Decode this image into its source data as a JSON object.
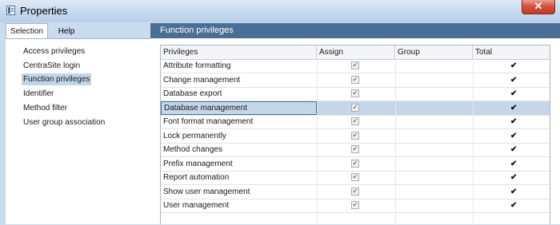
{
  "window": {
    "title": "Properties",
    "close_glyph": "✕",
    "icon": "properties-window-icon"
  },
  "left": {
    "tabs": [
      {
        "label": "Selection",
        "selected": true
      },
      {
        "label": "Help",
        "selected": false
      }
    ],
    "nav_items": [
      {
        "label": "Access privileges",
        "active": false
      },
      {
        "label": "CentraSite login",
        "active": false
      },
      {
        "label": "Function privileges",
        "active": true
      },
      {
        "label": "Identifier",
        "active": false
      },
      {
        "label": "Method filter",
        "active": false
      },
      {
        "label": "User group association",
        "active": false
      }
    ]
  },
  "right": {
    "header": "Function privileges",
    "columns": [
      "Privileges",
      "Assign",
      "Group",
      "Total"
    ],
    "rows": [
      {
        "name": "Attribute formatting",
        "assign": true,
        "total": "✔",
        "selected": false
      },
      {
        "name": "Change management",
        "assign": true,
        "total": "✔",
        "selected": false
      },
      {
        "name": "Database export",
        "assign": true,
        "total": "✔",
        "selected": false
      },
      {
        "name": "Database management",
        "assign": true,
        "total": "✔",
        "selected": true
      },
      {
        "name": "Font format management",
        "assign": true,
        "total": "✔",
        "selected": false
      },
      {
        "name": "Lock permanently",
        "assign": true,
        "total": "✔",
        "selected": false
      },
      {
        "name": "Method changes",
        "assign": true,
        "total": "✔",
        "selected": false
      },
      {
        "name": "Prefix management",
        "assign": true,
        "total": "✔",
        "selected": false
      },
      {
        "name": "Report automation",
        "assign": true,
        "total": "✔",
        "selected": false
      },
      {
        "name": "Show user management",
        "assign": true,
        "total": "✔",
        "selected": false
      },
      {
        "name": "User management",
        "assign": true,
        "total": "✔",
        "selected": false
      }
    ],
    "checkbox_glyph": "✔"
  },
  "colors": {
    "header_bg": "#4b6e96",
    "selected_row": "#c5d6e9",
    "close_button": "#d7523e",
    "frame": "#c9dcef"
  }
}
